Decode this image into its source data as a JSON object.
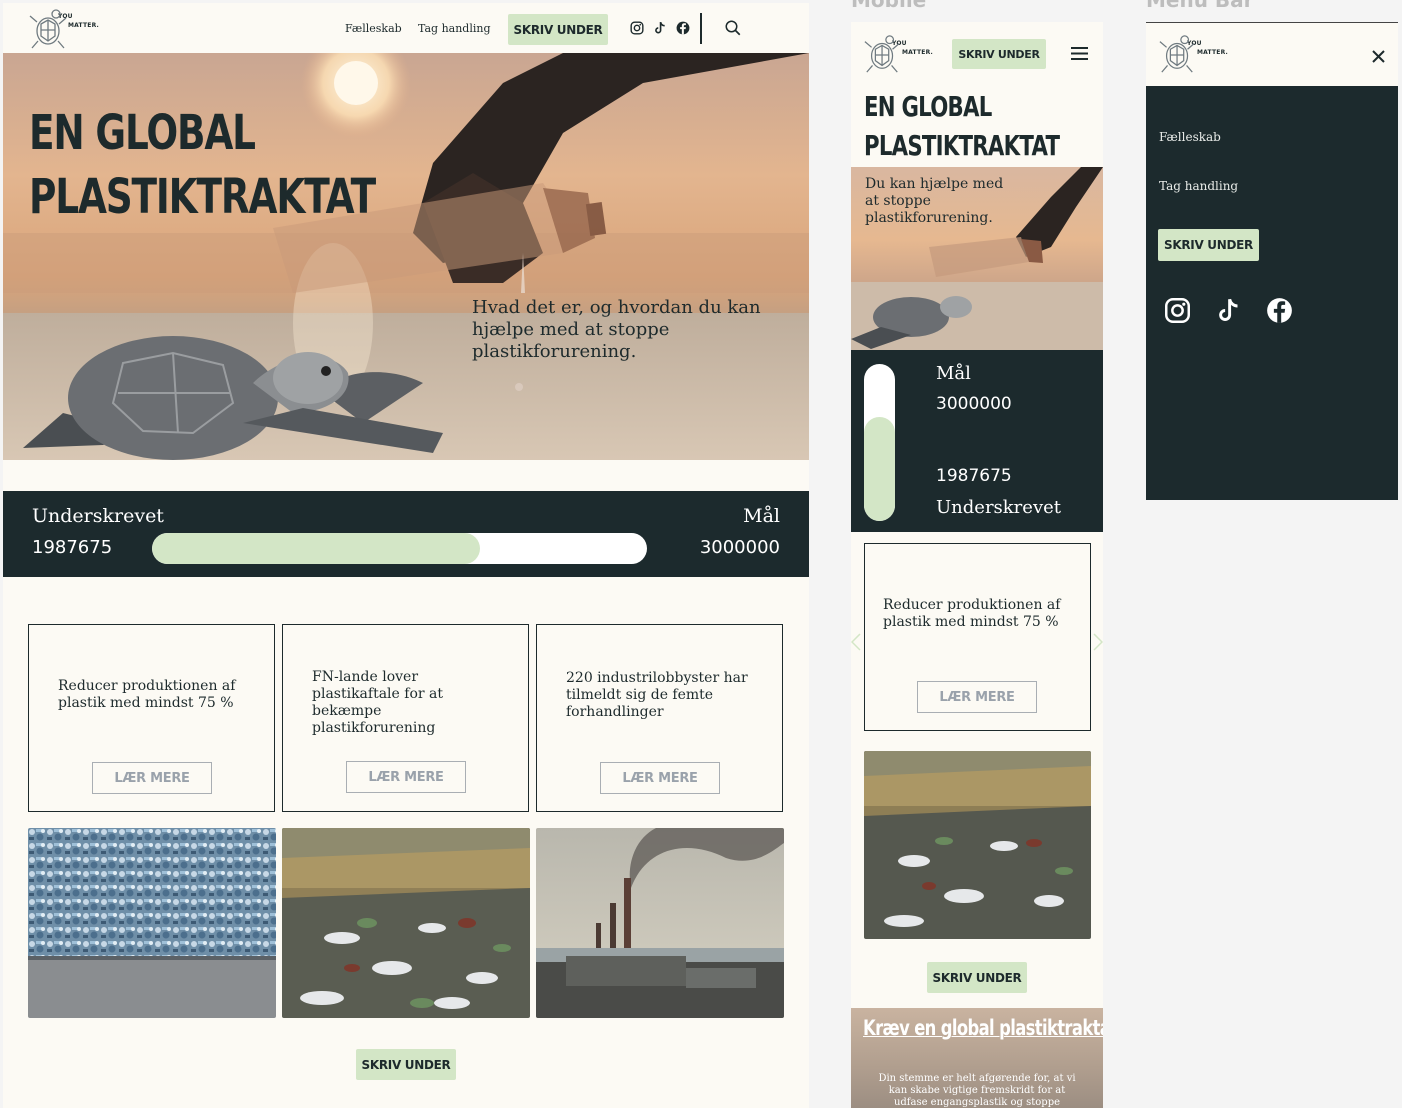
{
  "frames": {
    "mobile": "Mobile",
    "menu": "Menu Bar"
  },
  "brand": {
    "logo_line1": "YOU",
    "logo_line2": "MATTER."
  },
  "nav": {
    "links": [
      "Fælleskab",
      "Tag handling"
    ],
    "cta": "SKRIV UNDER"
  },
  "icons": [
    "instagram-icon",
    "tiktok-icon",
    "facebook-icon",
    "search-icon",
    "menu-icon",
    "close-icon"
  ],
  "hero": {
    "title_line1": "EN GLOBAL",
    "title_line2": "PLASTIKTRAKTAT",
    "subtitle": "Hvad det er, og hvordan du kan hjælpe med at stoppe plastikforurening."
  },
  "progress": {
    "signed_label": "Underskrevet",
    "signed_value": "1987675",
    "goal_label": "Mål",
    "goal_value": "3000000",
    "fraction": 0.6626
  },
  "cards": [
    {
      "text": "Reducer produktionen af plastik med mindst 75 %",
      "button": "LÆR MERE"
    },
    {
      "text": "FN-lande lover plastikaftale for at bekæmpe plastikforurening",
      "button": "LÆR MERE"
    },
    {
      "text": "220 industrilobbyster har tilmeldt sig de femte forhandlinger",
      "button": "LÆR MERE"
    }
  ],
  "bottom_cta": "SKRIV UNDER",
  "mobile": {
    "hero_text": "Du kan hjælpe med at stoppe plastikforurening.",
    "banner_title": "Kræv en global plastiktraktat",
    "banner_text": "Din stemme er helt afgørende for, at vi kan skabe vigtige fremskridt for at udfase engangsplastik og stoppe"
  },
  "colors": {
    "dark": "#1c2a2d",
    "green": "#d3e6c6",
    "cream": "#fcfaf4"
  }
}
